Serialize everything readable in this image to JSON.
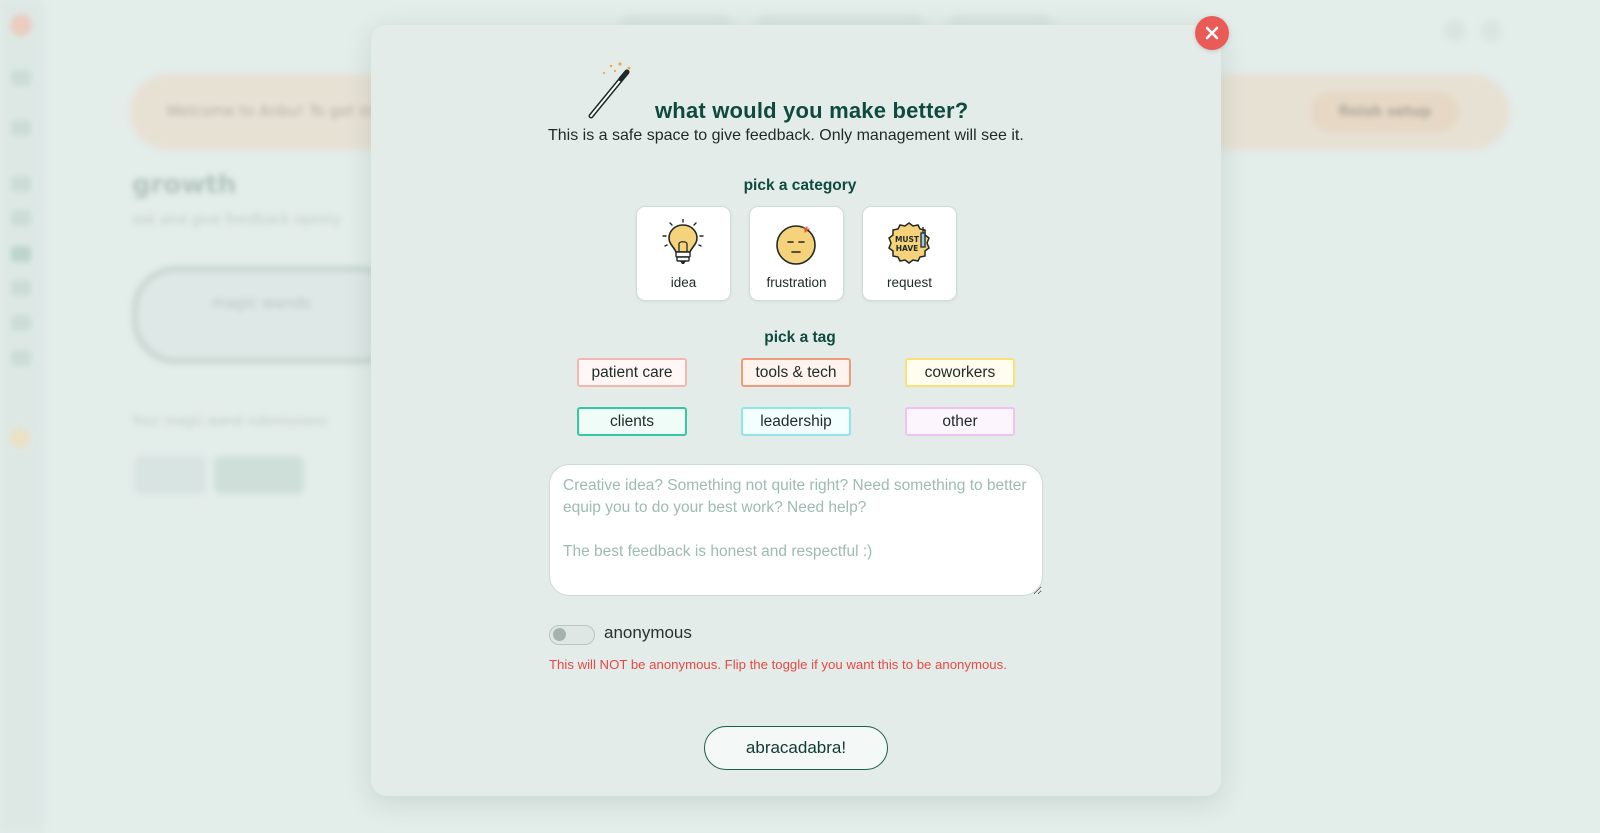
{
  "background": {
    "banner": {
      "text": "Welcome to Anbu! To get started",
      "button_label": "finish setup"
    },
    "page_title": "growth",
    "page_subtitle": "ask and give feedback openly",
    "card_label": "magic wands",
    "note": "Your magic wand submissions"
  },
  "modal": {
    "title": "what would you make better?",
    "subtitle": "This is a safe space to give feedback. Only management will see it.",
    "category_heading": "pick a category",
    "categories": [
      {
        "label": "idea",
        "icon": "lightbulb-icon"
      },
      {
        "label": "frustration",
        "icon": "frustrated-face-icon"
      },
      {
        "label": "request",
        "icon": "must-have-badge-icon",
        "badge_text": [
          "MUST",
          "HAVE"
        ]
      }
    ],
    "tag_heading": "pick a tag",
    "tags": [
      {
        "label": "patient care",
        "border": "#f2b8b0",
        "fill": "#fff7f6"
      },
      {
        "label": "tools & tech",
        "border": "#ef9a7a",
        "fill": "#fff3ee"
      },
      {
        "label": "coworkers",
        "border": "#f7e27a",
        "fill": "#fffdf0"
      },
      {
        "label": "clients",
        "border": "#33c9a3",
        "fill": "#effcf8"
      },
      {
        "label": "leadership",
        "border": "#8ee6ec",
        "fill": "#f3feff"
      },
      {
        "label": "other",
        "border": "#efc2f2",
        "fill": "#fdf5fe"
      }
    ],
    "feedback_placeholder": "Creative idea? Something not quite right? Need something to better equip you to do your best work? Need help?\n\nThe best feedback is honest and respectful :)",
    "feedback_value": "",
    "anonymous": {
      "label": "anonymous",
      "enabled": false
    },
    "warning": "This will NOT be anonymous. Flip the toggle if you want this to be anonymous.",
    "submit_label": "abracadabra!"
  },
  "colors": {
    "accent": "#0f4a3e",
    "close": "#ea5b57",
    "warning": "#e34a45",
    "modal_bg": "#e3ece9"
  }
}
